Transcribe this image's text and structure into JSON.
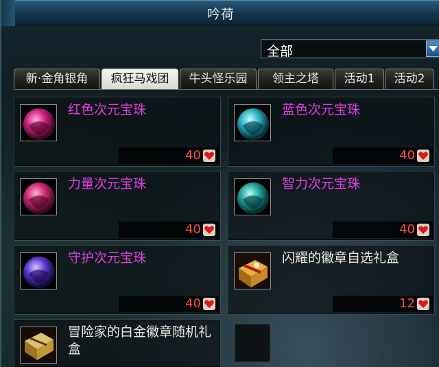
{
  "window": {
    "title": "吟荷"
  },
  "filter": {
    "selected": "全部"
  },
  "tabs": [
    {
      "label": "新·金角银角"
    },
    {
      "label": "疯狂马戏团"
    },
    {
      "label": "牛头怪乐园"
    },
    {
      "label": "领主之塔"
    },
    {
      "label": "活动1"
    },
    {
      "label": "活动2"
    }
  ],
  "active_tab": "疯狂马戏团",
  "items": [
    {
      "name": "红色次元宝珠",
      "price": "40",
      "icon": "red-orb-icon",
      "color": "#e0307a"
    },
    {
      "name": "蓝色次元宝珠",
      "price": "40",
      "icon": "blue-orb-icon",
      "color": "#31b6c8"
    },
    {
      "name": "力量次元宝珠",
      "price": "40",
      "icon": "strength-orb-icon",
      "color": "#e0307a"
    },
    {
      "name": "智力次元宝珠",
      "price": "40",
      "icon": "intelligence-orb-icon",
      "color": "#2aa6a8"
    },
    {
      "name": "守护次元宝珠",
      "price": "40",
      "icon": "guard-orb-icon",
      "color": "#6a4ad8"
    },
    {
      "name": "闪耀的徽章自选礼盒",
      "price": "12",
      "icon": "badge-giftbox-icon",
      "color": "#d8a030"
    },
    {
      "name": "冒险家的白金徽章随机礼盒",
      "price": "",
      "icon": "platinum-giftbox-icon",
      "color": "#c89a40"
    }
  ],
  "colors": {
    "accent": "#e03ee0",
    "price": "#ff4a4a",
    "title_bar": "#13364c"
  }
}
